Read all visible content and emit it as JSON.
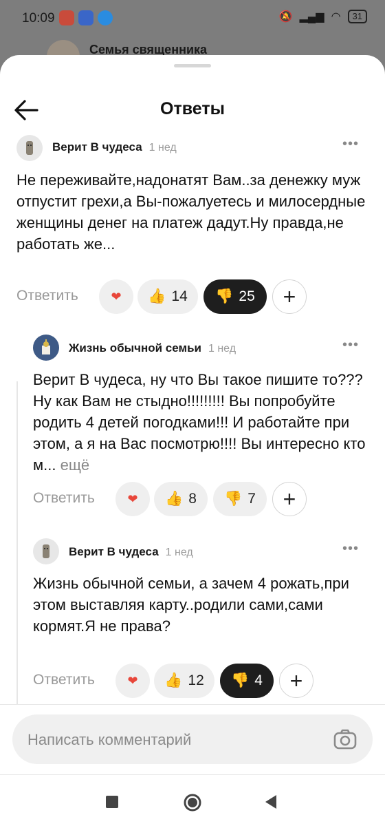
{
  "status_bar": {
    "time": "10:09",
    "battery": "31"
  },
  "background_screen": {
    "title": "Семья священника"
  },
  "header": {
    "title": "Ответы"
  },
  "comments": [
    {
      "author": "Верит В чудеса",
      "time": "1 нед",
      "text": "Не переживайте,надонатят Вам..за денежку муж отпустит грехи,а Вы-пожалуетесь и милосердные женщины денег на платеж дадут.Ну правда,не работать же...",
      "reply_label": "Ответить",
      "likes": "14",
      "dislikes": "25"
    },
    {
      "author": "Жизнь обычной семьи",
      "time": "1 нед",
      "text": "Верит В чудеса, ну что Вы такое пишите то??? Ну как Вам не стыдно!!!!!!!!! Вы попробуйте родить 4 детей погодками!!! И работайте при этом, а я на Вас посмотрю!!!! Вы интересно кто м...",
      "more_link": "ещё",
      "reply_label": "Ответить",
      "likes": "8",
      "dislikes": "7"
    },
    {
      "author": "Верит В чудеса",
      "time": "1 нед",
      "text": "Жизнь обычной семьи, а зачем 4 рожать,при этом выставляя карту..родили сами,сами кормят.Я не права?",
      "reply_label": "Ответить",
      "likes": "12",
      "dislikes": "4"
    }
  ],
  "comment_input": {
    "placeholder": "Написать комментарий"
  },
  "icons": {
    "back": "arrow-left-icon",
    "more": "more-dots-icon",
    "like": "thumbs-up-icon",
    "dislike": "thumbs-down-icon",
    "add_reaction": "plus-icon",
    "camera": "camera-icon"
  },
  "colors": {
    "dark_pill": "#1e1e1e",
    "pill": "#efefef",
    "muted_text": "#999999"
  }
}
